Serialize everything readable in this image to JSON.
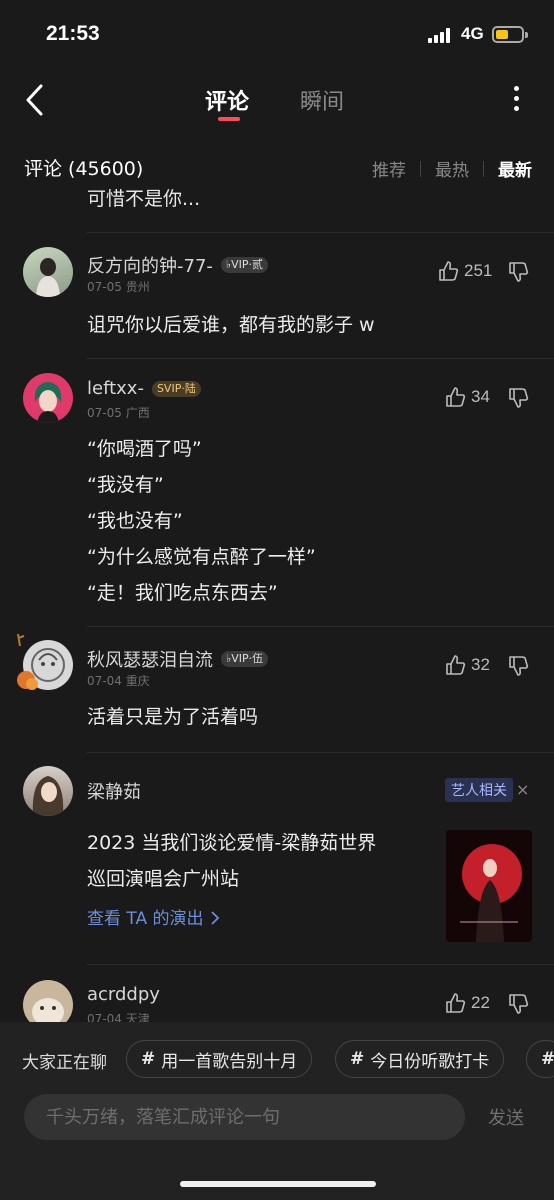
{
  "status_bar": {
    "time": "21:53",
    "network": "4G"
  },
  "nav": {
    "tabs": [
      {
        "label": "评论"
      },
      {
        "label": "瞬间"
      }
    ]
  },
  "comments_header": {
    "title": "评论 (45600)",
    "sort": [
      {
        "label": "推荐"
      },
      {
        "label": "最热"
      },
      {
        "label": "最新"
      }
    ]
  },
  "truncated_text": "可惜不是你...",
  "comments": [
    {
      "username": "反方向的钟-77-",
      "vip": "♭VIP·贰",
      "date": "07-05",
      "location": "贵州",
      "likes": "251",
      "lines": [
        "诅咒你以后爱谁，都有我的影子 w"
      ]
    },
    {
      "username": "leftxx-",
      "vip": "SVIP·陆",
      "date": "07-05",
      "location": "广西",
      "likes": "34",
      "lines": [
        "“你喝酒了吗”",
        "“我没有”",
        "“我也没有”",
        "“为什么感觉有点醉了一样”",
        "“走！我们吃点东西去”"
      ]
    },
    {
      "username": "秋风瑟瑟泪自流",
      "vip": "♭VIP·伍",
      "date": "07-04",
      "location": "重庆",
      "likes": "32",
      "lines": [
        "活着只是为了活着吗"
      ]
    },
    {
      "username": "acrddpy",
      "date": "07-04",
      "location": "天津",
      "likes": "22"
    }
  ],
  "artist_card": {
    "name": "梁静茹",
    "tag": "艺人相关",
    "close": "×",
    "lines": [
      "2023 当我们谈论爱情-梁静茹世界",
      "巡回演唱会广州站"
    ],
    "link": "查看 TA 的演出",
    "link_icon": "chevron-right-icon"
  },
  "bottom": {
    "chat_label": "大家正在聊",
    "topics": [
      {
        "label": "用一首歌告别十月"
      },
      {
        "label": "今日份听歌打卡"
      },
      {
        "label": ""
      }
    ],
    "input_placeholder": "千头万绪，落笔汇成评论一句",
    "send_label": "发送"
  },
  "colors": {
    "accent": "#ff4a5a",
    "background": "#1a1a1a",
    "link": "#6a8fd8",
    "battery": "#f5c518"
  }
}
